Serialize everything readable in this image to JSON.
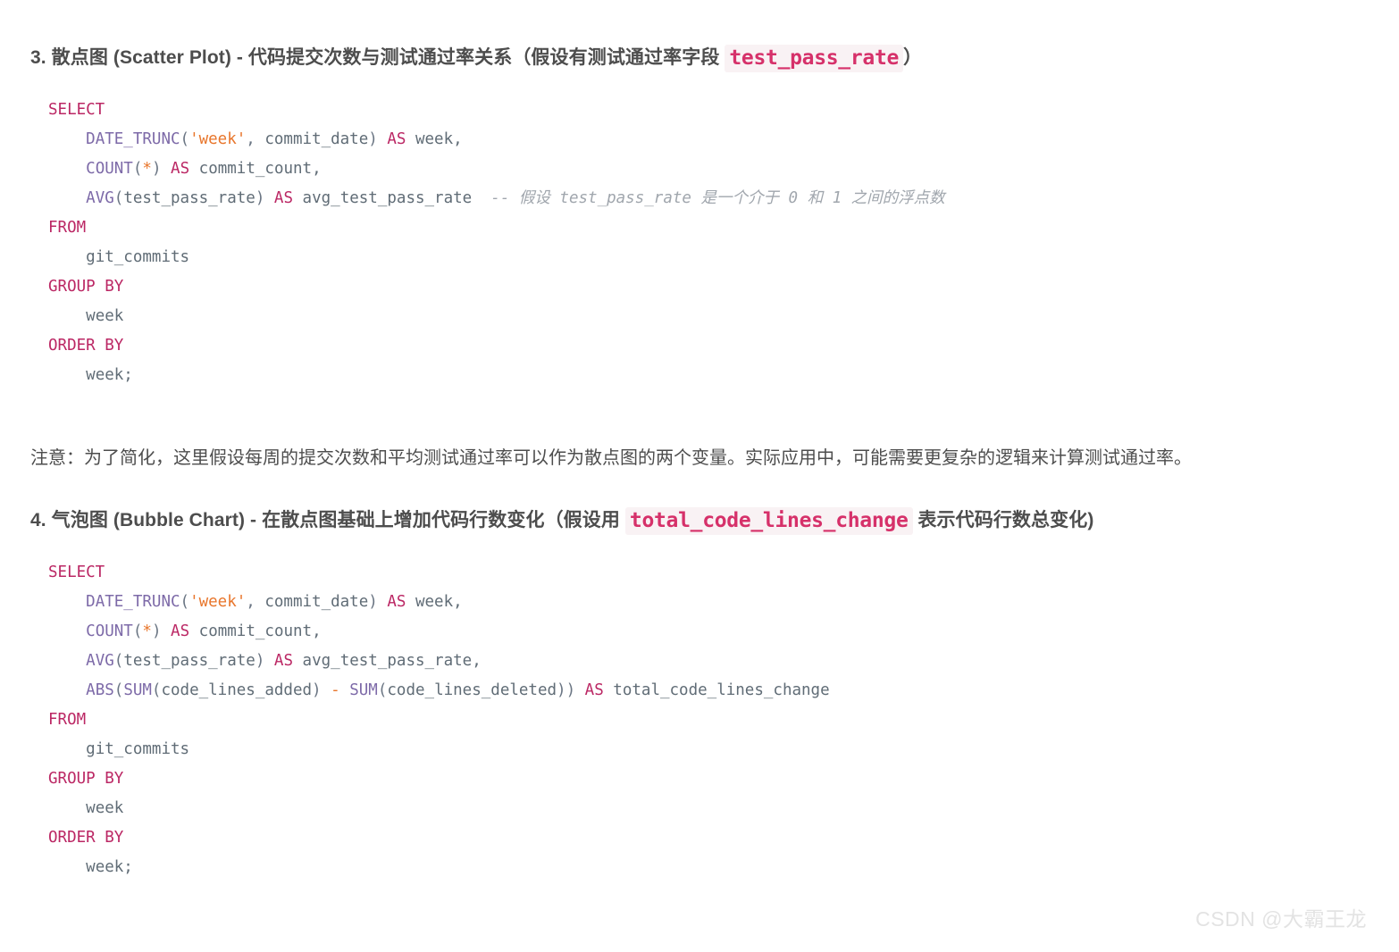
{
  "document": {
    "background_color": "#ffffff",
    "text_color": "#4d4d4d"
  },
  "sections": [
    {
      "heading": {
        "prefix": "3. 散点图 (Scatter Plot) - 代码提交次数与测试通过率关系（假设有测试通过率字段 ",
        "code": "test_pass_rate",
        "suffix": "）"
      },
      "code_block": {
        "language": "sql",
        "lines": [
          "SELECT",
          "    DATE_TRUNC('week', commit_date) AS week,",
          "    COUNT(*) AS commit_count,",
          "    AVG(test_pass_rate) AS avg_test_pass_rate  -- 假设 test_pass_rate 是一个介于 0 和 1 之间的浮点数",
          "FROM",
          "    git_commits",
          "GROUP BY",
          "    week",
          "ORDER BY",
          "    week;"
        ],
        "tokens": {
          "l1_select": "SELECT",
          "l2_fn": "DATE_TRUNC",
          "l2_str": "'week'",
          "l2_arg": "commit_date",
          "l2_as": "AS",
          "l2_alias": "week,",
          "l3_fn": "COUNT",
          "l3_star": "*",
          "l3_as": "AS",
          "l3_alias": "commit_count,",
          "l4_fn": "AVG",
          "l4_arg": "test_pass_rate",
          "l4_as": "AS",
          "l4_alias": "avg_test_pass_rate",
          "l4_comment": "-- 假设 test_pass_rate 是一个介于 0 和 1 之间的浮点数",
          "l5_from": "FROM",
          "l6_table": "git_commits",
          "l7_groupby": "GROUP BY",
          "l8_col": "week",
          "l9_orderby": "ORDER BY",
          "l10_col": "week;"
        }
      },
      "note": "注意：为了简化，这里假设每周的提交次数和平均测试通过率可以作为散点图的两个变量。实际应用中，可能需要更复杂的逻辑来计算测试通过率。"
    },
    {
      "heading": {
        "prefix": "4. 气泡图 (Bubble Chart) - 在散点图基础上增加代码行数变化（假设用 ",
        "code": "total_code_lines_change",
        "suffix": " 表示代码行数总变化)"
      },
      "code_block": {
        "language": "sql",
        "lines": [
          "SELECT",
          "    DATE_TRUNC('week', commit_date) AS week,",
          "    COUNT(*) AS commit_count,",
          "    AVG(test_pass_rate) AS avg_test_pass_rate,",
          "    ABS(SUM(code_lines_added) - SUM(code_lines_deleted)) AS total_code_lines_change",
          "FROM",
          "    git_commits",
          "GROUP BY",
          "    week",
          "ORDER BY",
          "    week;"
        ],
        "tokens": {
          "l1_select": "SELECT",
          "l2_fn": "DATE_TRUNC",
          "l2_str": "'week'",
          "l2_arg": "commit_date",
          "l2_as": "AS",
          "l2_alias": "week,",
          "l3_fn": "COUNT",
          "l3_star": "*",
          "l3_as": "AS",
          "l3_alias": "commit_count,",
          "l4_fn": "AVG",
          "l4_arg": "test_pass_rate",
          "l4_as": "AS",
          "l4_alias": "avg_test_pass_rate,",
          "l5_fn_abs": "ABS",
          "l5_fn_sum1": "SUM",
          "l5_arg1": "code_lines_added",
          "l5_minus": "-",
          "l5_fn_sum2": "SUM",
          "l5_arg2": "code_lines_deleted",
          "l5_as": "AS",
          "l5_alias": "total_code_lines_change",
          "l6_from": "FROM",
          "l7_table": "git_commits",
          "l8_groupby": "GROUP BY",
          "l9_col": "week",
          "l10_orderby": "ORDER BY",
          "l11_col": "week;"
        }
      }
    }
  ],
  "watermark": "CSDN @大霸王龙",
  "syntax_colors": {
    "keyword": "#bb2764",
    "function": "#7d6aa8",
    "string": "#e8762c",
    "operator": "#e8762c",
    "identifier": "#606c76",
    "punctuation": "#6a7583",
    "comment": "#a0a6ad",
    "inline_code_text": "#d6316a",
    "inline_code_bg": "#f9f2f4"
  }
}
